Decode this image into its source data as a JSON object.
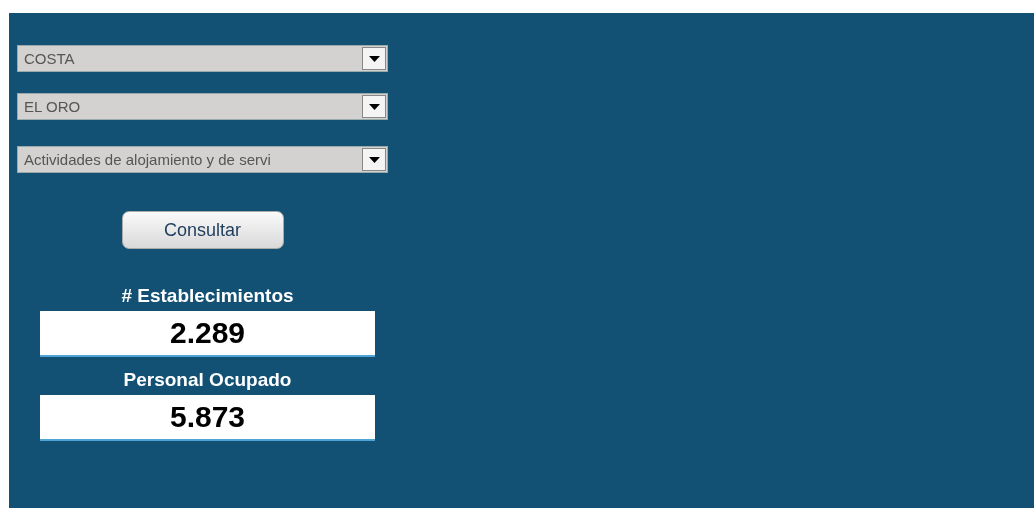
{
  "filters": [
    {
      "value": "COSTA"
    },
    {
      "value": "EL ORO"
    },
    {
      "value": "Actividades de alojamiento y de servi"
    }
  ],
  "button": {
    "label": "Consultar"
  },
  "metrics": [
    {
      "label": "# Establecimientos",
      "value": "2.289"
    },
    {
      "label": "Personal Ocupado",
      "value": "5.873"
    }
  ]
}
